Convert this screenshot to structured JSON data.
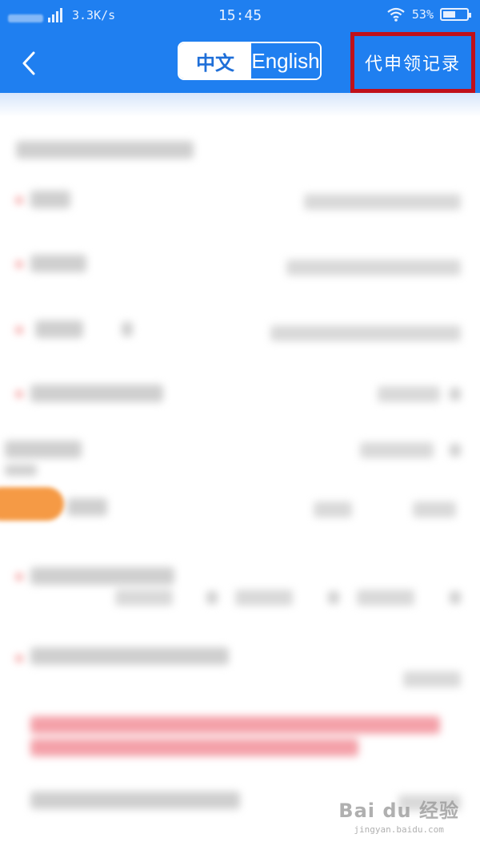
{
  "status_bar": {
    "network_speed": "3.3K/s",
    "time": "15:45",
    "battery_percent": "53%",
    "battery_level": 0.53,
    "icons": [
      "signal-icon",
      "wifi-icon",
      "battery-icon"
    ]
  },
  "header": {
    "back_icon": "chevron-left-icon",
    "lang_options": [
      "中文",
      "English"
    ],
    "lang_selected": "中文",
    "record_button_label": "代申领记录"
  },
  "watermark": {
    "main": "Bai du 经验",
    "sub": "jingyan.baidu.com"
  },
  "colors": {
    "header_bg": "#1f7ff0",
    "highlight_border": "#c0101a"
  }
}
